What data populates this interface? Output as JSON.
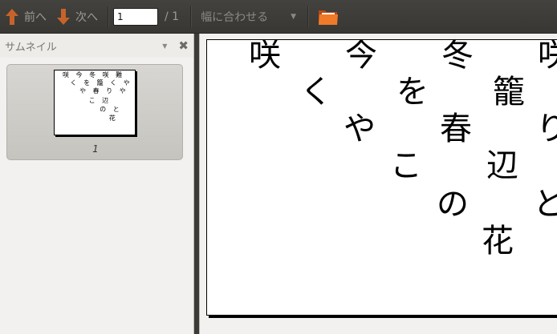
{
  "toolbar": {
    "prev_label": "前へ",
    "next_label": "次へ",
    "page_value": "1",
    "page_total": "/ 1",
    "zoom_label": "幅に合わせる",
    "icons": {
      "prev": "arrow-up-icon",
      "next": "arrow-down-icon",
      "zoom_dropdown": "chevron-down-icon",
      "open": "folder-icon"
    },
    "colors": {
      "arrow": "#c7632a",
      "folder": "#e8641c"
    }
  },
  "sidebar": {
    "title": "サムネイル",
    "thumbnail_page_number": "1",
    "thumbnail_lines": [
      "咲 今 冬 咲 難",
      " く を 籠 く や",
      "  や 春 り や",
      "   こ 辺",
      "    の と",
      "     花"
    ]
  },
  "document": {
    "lines": [
      "咲　今　冬　咲　難",
      "　く　を　籠　く　や",
      "　　や　春　り　や",
      "　　　こ　辺",
      "　　　　の　と",
      "　　　　　花"
    ]
  }
}
